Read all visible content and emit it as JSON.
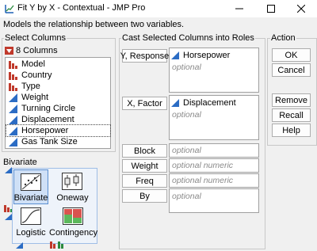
{
  "window": {
    "title": "Fit Y by X - Contextual - JMP Pro",
    "subtitle": "Models the relationship between two variables.",
    "controls": [
      "minimize-icon",
      "maximize-icon",
      "close-icon"
    ]
  },
  "select_columns": {
    "label": "Select Columns",
    "count_label": "8 Columns",
    "items": [
      {
        "label": "Model",
        "icon": "nominal-icon"
      },
      {
        "label": "Country",
        "icon": "nominal-icon"
      },
      {
        "label": "Type",
        "icon": "nominal-icon"
      },
      {
        "label": "Weight",
        "icon": "continuous-icon"
      },
      {
        "label": "Turning Circle",
        "icon": "continuous-icon"
      },
      {
        "label": "Displacement",
        "icon": "continuous-icon"
      },
      {
        "label": "Horsepower",
        "icon": "continuous-icon"
      },
      {
        "label": "Gas Tank Size",
        "icon": "continuous-icon"
      }
    ],
    "selected": "Horsepower"
  },
  "cast": {
    "label": "Cast Selected Columns into Roles",
    "y_button": "Y, Response",
    "y_value": "Horsepower",
    "y_optional": "optional",
    "x_button": "X, Factor",
    "x_value": "Displacement",
    "x_optional": "optional",
    "block_button": "Block",
    "block_optional": "optional",
    "weight_button": "Weight",
    "weight_optional": "optional numeric",
    "freq_button": "Freq",
    "freq_optional": "optional numeric",
    "by_button": "By",
    "by_optional": "optional"
  },
  "action": {
    "label": "Action",
    "ok": "OK",
    "cancel": "Cancel",
    "remove": "Remove",
    "recall": "Recall",
    "help": "Help"
  },
  "bivariate": {
    "label": "Bivariate",
    "platforms": [
      "Bivariate",
      "Oneway",
      "Logistic",
      "Contingency"
    ],
    "selected": "Bivariate"
  },
  "colors": {
    "nominal": "#c0392b",
    "continuous": "#2b6cc4",
    "accent": "#7fa6d6"
  }
}
